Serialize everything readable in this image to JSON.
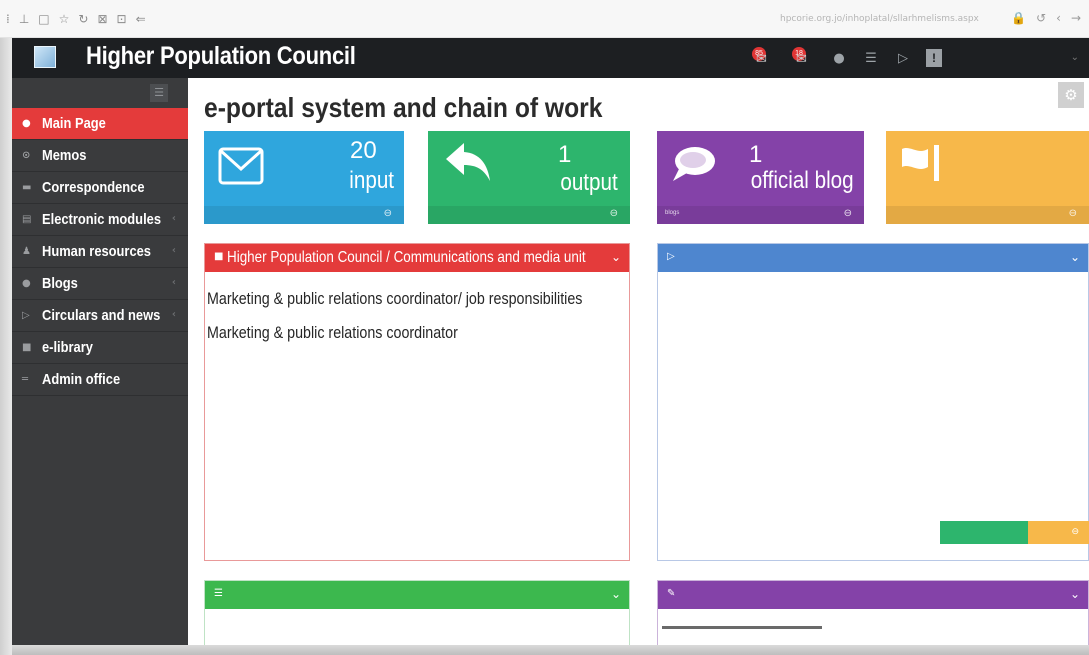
{
  "browser": {
    "url": "hpcorie.org.jo/inhoplatal/sllarhmelisms.aspx",
    "icons": [
      "bookmark-icon",
      "save-icon",
      "tab-icon",
      "star-icon",
      "refresh-icon",
      "pin-icon",
      "screen-icon",
      "back-icon"
    ]
  },
  "header": {
    "app_title": "Higher Population Council",
    "badge_mail_count": "85",
    "badge_out_count": "18",
    "avatar_letter": "!"
  },
  "sidebar": {
    "items": [
      {
        "label": "Main Page",
        "icon": "home-icon",
        "glyph": "●",
        "active": true,
        "has_arrow": false
      },
      {
        "label": "Memos",
        "icon": "memo-icon",
        "glyph": "⊙",
        "active": false,
        "has_arrow": false
      },
      {
        "label": "Correspondence",
        "icon": "envelope-icon",
        "glyph": "▬",
        "active": false,
        "has_arrow": false
      },
      {
        "label": "Electronic modules",
        "icon": "module-icon",
        "glyph": "▤",
        "active": false,
        "has_arrow": true
      },
      {
        "label": "Human resources",
        "icon": "user-icon",
        "glyph": "♟",
        "active": false,
        "has_arrow": true
      },
      {
        "label": "Blogs",
        "icon": "blog-icon",
        "glyph": "●",
        "active": false,
        "has_arrow": true
      },
      {
        "label": "Circulars and news",
        "icon": "news-icon",
        "glyph": "▷",
        "active": false,
        "has_arrow": true
      },
      {
        "label": "e-library",
        "icon": "library-icon",
        "glyph": "■",
        "active": false,
        "has_arrow": false
      },
      {
        "label": "Admin office",
        "icon": "office-icon",
        "glyph": "═",
        "active": false,
        "has_arrow": false
      }
    ]
  },
  "main": {
    "page_title": "e-portal system and chain of work",
    "tiles": [
      {
        "count": "20",
        "label": "input",
        "color": "#2fa6dd",
        "icon": "envelope-icon"
      },
      {
        "count": "1",
        "label": "output",
        "color": "#2db56d",
        "icon": "reply-icon"
      },
      {
        "count": "1",
        "label": "official blog",
        "color": "#8442a8",
        "icon": "chat-icon",
        "footer_text": "blogs"
      },
      {
        "count": "",
        "label": "",
        "color": "#f7b84a",
        "icon": "flag-icon"
      }
    ],
    "panels": {
      "communications": {
        "title": "Higher Population Council / Communications and media unit",
        "lines": [
          "Marketing & public relations coordinator/ job responsibilities",
          "Marketing & public relations coordinator"
        ],
        "color": "#e43b3b"
      },
      "circulars": {
        "title": "",
        "color": "#4e86cf"
      },
      "correspondence": {
        "title": "",
        "color": "#3cb84e"
      },
      "blogs": {
        "title": "",
        "color": "#8442a8"
      }
    }
  }
}
